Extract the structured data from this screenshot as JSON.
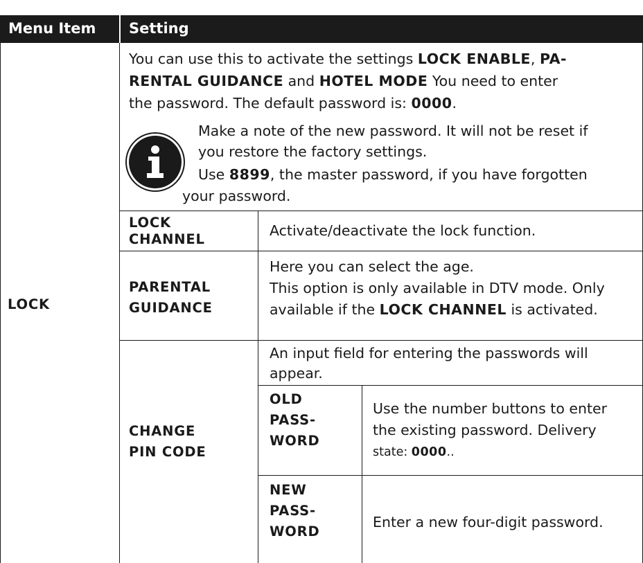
{
  "header": {
    "menu_item": "Menu Item",
    "setting": "Setting"
  },
  "lock": {
    "label": "LOCK",
    "intro_l1a": "You can use this to activate the settings ",
    "intro_l1b": "LOCK ENABLE",
    "intro_l1c": ", ",
    "intro_l1d": "PA-",
    "intro_l2a": "RENTAL GUIDANCE",
    "intro_l2b": " and ",
    "intro_l2c": "HOTEL MODE",
    "intro_l2d": "  You need to enter",
    "intro_l3a": "the password. The default password is: ",
    "intro_l3b": "0000",
    "intro_l3c": ".",
    "note_l1": "Make a note of the new password. It will not be reset if",
    "note_l2": "you restore the factory settings.",
    "note_l3a": "Use ",
    "note_l3b": "8899",
    "note_l3c": ", the master password, if you have forgotten",
    "note_l4": "your password.",
    "info_icon": "info-icon"
  },
  "rows": {
    "lock_channel": {
      "label_l1": "LOCK",
      "label_l2": "CHANNEL",
      "desc": "Activate/deactivate the lock function."
    },
    "parental": {
      "label_l1": "PARENTAL",
      "label_l2": "GUIDANCE",
      "desc_l1": "Here you can select the age.",
      "desc_l2": "This option is only available in DTV mode. Only",
      "desc_l3a": "available if the ",
      "desc_l3b": "LOCK CHANNEL",
      "desc_l3c": " is activated."
    },
    "pin": {
      "label_l1": "CHANGE",
      "label_l2": "PIN CODE",
      "desc_l1": "An input field for entering the passwords will",
      "desc_l2": "appear.",
      "old": {
        "label_l1": "OLD",
        "label_l2": "PASS-",
        "label_l3": "WORD",
        "desc_l1": "Use the number buttons to enter",
        "desc_l2": "the existing password. Delivery",
        "desc_l3a": "state: ",
        "desc_l3b": "0000",
        "desc_l3c": ".."
      },
      "new": {
        "label_l1": "NEW",
        "label_l2": "PASS-",
        "label_l3": "WORD",
        "desc": "Enter a new four-digit password."
      }
    }
  }
}
